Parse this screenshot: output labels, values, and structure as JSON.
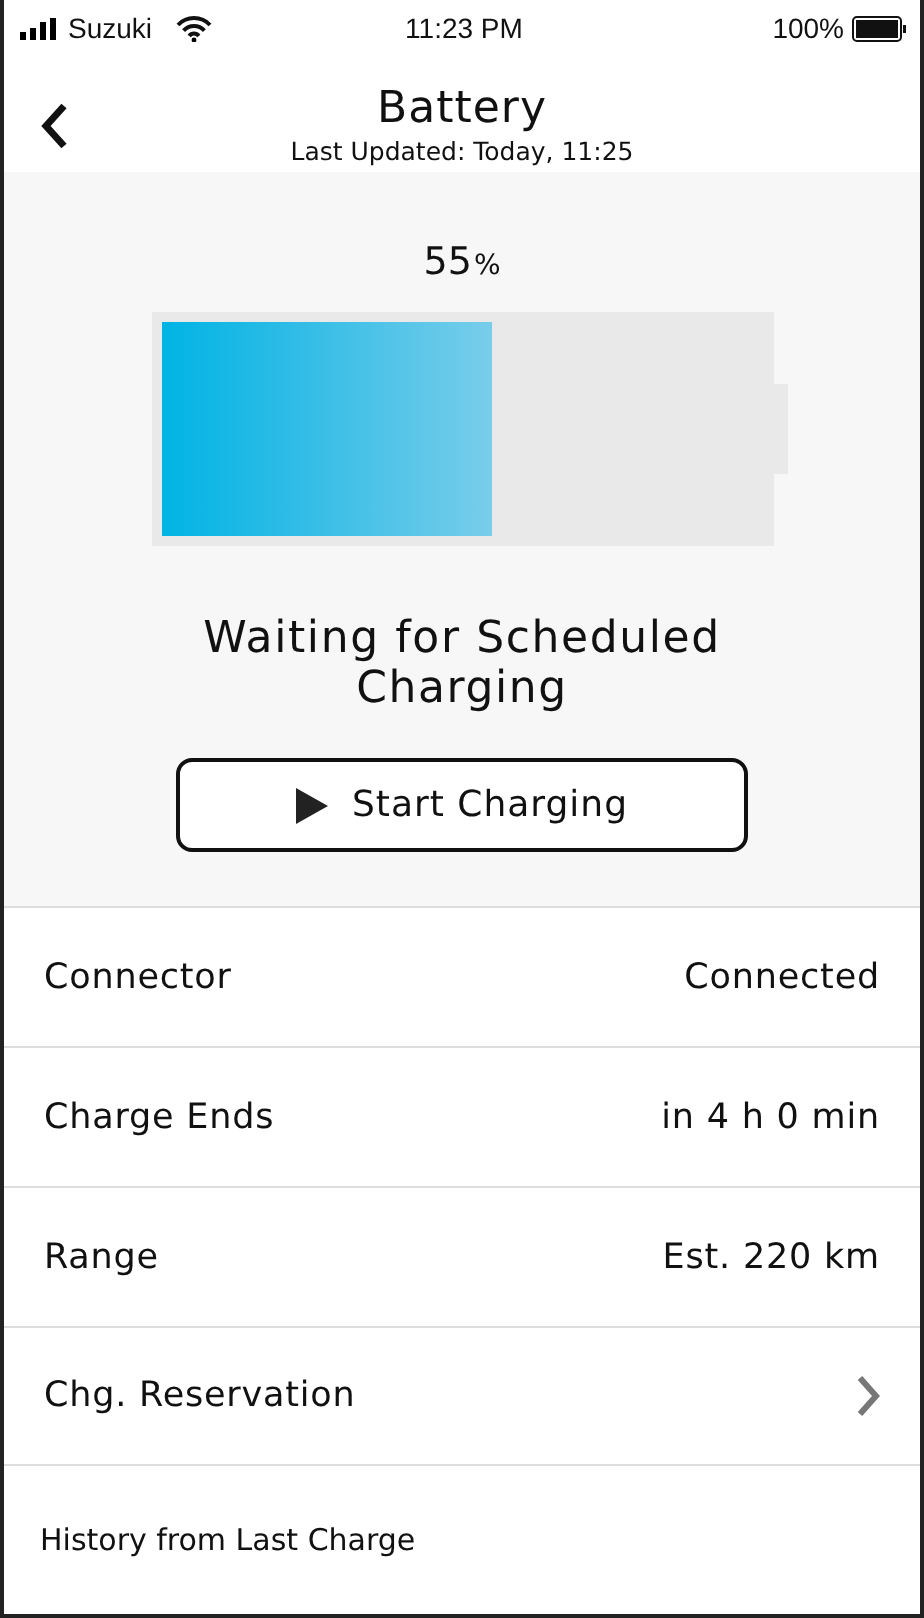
{
  "status_bar": {
    "carrier": "Suzuki",
    "time": "11:23 PM",
    "battery": "100%"
  },
  "header": {
    "title": "Battery",
    "subtitle": "Last Updated: Today, 11:25"
  },
  "battery": {
    "value": "55",
    "unit": "%",
    "level": 0.55
  },
  "status": "Waiting for Scheduled Charging",
  "start_button": {
    "label": "Start Charging"
  },
  "rows": [
    {
      "label": "Connector",
      "value": "Connected",
      "kind": "value"
    },
    {
      "label": "Charge Ends",
      "value": "in 4 h 0 min",
      "kind": "value"
    },
    {
      "label": "Range",
      "value": "Est. 220 km",
      "kind": "value"
    },
    {
      "label": "Chg. Reservation",
      "kind": "link"
    }
  ],
  "footer": "History from Last Charge"
}
